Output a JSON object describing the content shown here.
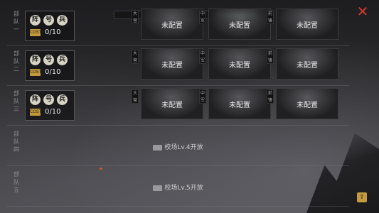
{
  "top_bar": {
    "close_icon": "close-icon"
  },
  "troops": [
    {
      "label": "部\n队\n一",
      "unlocked": true,
      "seals": [
        "阵",
        "号",
        "兵"
      ],
      "cost_icon_text": "COST",
      "cost": "0/10",
      "slots": [
        {
          "role": "大营",
          "text": "未配置"
        },
        {
          "role": "中军",
          "text": "未配置"
        },
        {
          "role": "前锋",
          "text": "未配置"
        }
      ]
    },
    {
      "label": "部\n队\n二",
      "unlocked": true,
      "seals": [
        "阵",
        "号",
        "兵"
      ],
      "cost_icon_text": "COST",
      "cost": "0/10",
      "slots": [
        {
          "role": "大营",
          "text": "未配置"
        },
        {
          "role": "中军",
          "text": "未配置"
        },
        {
          "role": "前锋",
          "text": "未配置"
        }
      ]
    },
    {
      "label": "部\n队\n三",
      "unlocked": true,
      "seals": [
        "阵",
        "号",
        "兵"
      ],
      "cost_icon_text": "COST",
      "cost": "0/10",
      "slots": [
        {
          "role": "大营",
          "text": "未配置"
        },
        {
          "role": "中军",
          "text": "未配置"
        },
        {
          "role": "前锋",
          "text": "未配置"
        }
      ]
    },
    {
      "label": "部\n队\n四",
      "unlocked": false,
      "lock_text": "校场Lv.4开放"
    },
    {
      "label": "部\n队\n五",
      "unlocked": false,
      "lock_text": "校场Lv.5开放"
    }
  ],
  "share_icon": "share-icon",
  "colors": {
    "close": "#d13a2c",
    "accent": "#c69b3e"
  }
}
